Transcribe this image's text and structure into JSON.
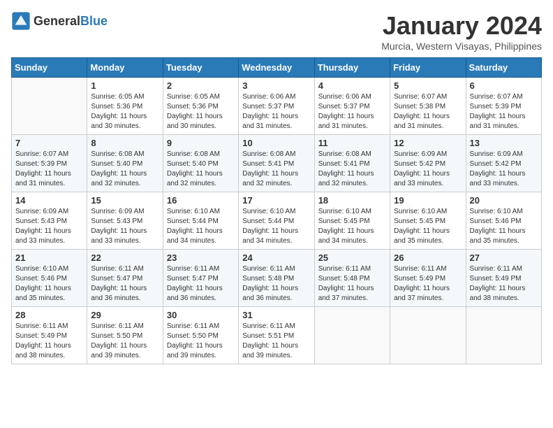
{
  "header": {
    "logo_general": "General",
    "logo_blue": "Blue",
    "month_year": "January 2024",
    "location": "Murcia, Western Visayas, Philippines"
  },
  "weekdays": [
    "Sunday",
    "Monday",
    "Tuesday",
    "Wednesday",
    "Thursday",
    "Friday",
    "Saturday"
  ],
  "weeks": [
    [
      {
        "day": "",
        "content": ""
      },
      {
        "day": "1",
        "content": "Sunrise: 6:05 AM\nSunset: 5:36 PM\nDaylight: 11 hours\nand 30 minutes."
      },
      {
        "day": "2",
        "content": "Sunrise: 6:05 AM\nSunset: 5:36 PM\nDaylight: 11 hours\nand 30 minutes."
      },
      {
        "day": "3",
        "content": "Sunrise: 6:06 AM\nSunset: 5:37 PM\nDaylight: 11 hours\nand 31 minutes."
      },
      {
        "day": "4",
        "content": "Sunrise: 6:06 AM\nSunset: 5:37 PM\nDaylight: 11 hours\nand 31 minutes."
      },
      {
        "day": "5",
        "content": "Sunrise: 6:07 AM\nSunset: 5:38 PM\nDaylight: 11 hours\nand 31 minutes."
      },
      {
        "day": "6",
        "content": "Sunrise: 6:07 AM\nSunset: 5:39 PM\nDaylight: 11 hours\nand 31 minutes."
      }
    ],
    [
      {
        "day": "7",
        "content": "Sunrise: 6:07 AM\nSunset: 5:39 PM\nDaylight: 11 hours\nand 31 minutes."
      },
      {
        "day": "8",
        "content": "Sunrise: 6:08 AM\nSunset: 5:40 PM\nDaylight: 11 hours\nand 32 minutes."
      },
      {
        "day": "9",
        "content": "Sunrise: 6:08 AM\nSunset: 5:40 PM\nDaylight: 11 hours\nand 32 minutes."
      },
      {
        "day": "10",
        "content": "Sunrise: 6:08 AM\nSunset: 5:41 PM\nDaylight: 11 hours\nand 32 minutes."
      },
      {
        "day": "11",
        "content": "Sunrise: 6:08 AM\nSunset: 5:41 PM\nDaylight: 11 hours\nand 32 minutes."
      },
      {
        "day": "12",
        "content": "Sunrise: 6:09 AM\nSunset: 5:42 PM\nDaylight: 11 hours\nand 33 minutes."
      },
      {
        "day": "13",
        "content": "Sunrise: 6:09 AM\nSunset: 5:42 PM\nDaylight: 11 hours\nand 33 minutes."
      }
    ],
    [
      {
        "day": "14",
        "content": "Sunrise: 6:09 AM\nSunset: 5:43 PM\nDaylight: 11 hours\nand 33 minutes."
      },
      {
        "day": "15",
        "content": "Sunrise: 6:09 AM\nSunset: 5:43 PM\nDaylight: 11 hours\nand 33 minutes."
      },
      {
        "day": "16",
        "content": "Sunrise: 6:10 AM\nSunset: 5:44 PM\nDaylight: 11 hours\nand 34 minutes."
      },
      {
        "day": "17",
        "content": "Sunrise: 6:10 AM\nSunset: 5:44 PM\nDaylight: 11 hours\nand 34 minutes."
      },
      {
        "day": "18",
        "content": "Sunrise: 6:10 AM\nSunset: 5:45 PM\nDaylight: 11 hours\nand 34 minutes."
      },
      {
        "day": "19",
        "content": "Sunrise: 6:10 AM\nSunset: 5:45 PM\nDaylight: 11 hours\nand 35 minutes."
      },
      {
        "day": "20",
        "content": "Sunrise: 6:10 AM\nSunset: 5:46 PM\nDaylight: 11 hours\nand 35 minutes."
      }
    ],
    [
      {
        "day": "21",
        "content": "Sunrise: 6:10 AM\nSunset: 5:46 PM\nDaylight: 11 hours\nand 35 minutes."
      },
      {
        "day": "22",
        "content": "Sunrise: 6:11 AM\nSunset: 5:47 PM\nDaylight: 11 hours\nand 36 minutes."
      },
      {
        "day": "23",
        "content": "Sunrise: 6:11 AM\nSunset: 5:47 PM\nDaylight: 11 hours\nand 36 minutes."
      },
      {
        "day": "24",
        "content": "Sunrise: 6:11 AM\nSunset: 5:48 PM\nDaylight: 11 hours\nand 36 minutes."
      },
      {
        "day": "25",
        "content": "Sunrise: 6:11 AM\nSunset: 5:48 PM\nDaylight: 11 hours\nand 37 minutes."
      },
      {
        "day": "26",
        "content": "Sunrise: 6:11 AM\nSunset: 5:49 PM\nDaylight: 11 hours\nand 37 minutes."
      },
      {
        "day": "27",
        "content": "Sunrise: 6:11 AM\nSunset: 5:49 PM\nDaylight: 11 hours\nand 38 minutes."
      }
    ],
    [
      {
        "day": "28",
        "content": "Sunrise: 6:11 AM\nSunset: 5:49 PM\nDaylight: 11 hours\nand 38 minutes."
      },
      {
        "day": "29",
        "content": "Sunrise: 6:11 AM\nSunset: 5:50 PM\nDaylight: 11 hours\nand 39 minutes."
      },
      {
        "day": "30",
        "content": "Sunrise: 6:11 AM\nSunset: 5:50 PM\nDaylight: 11 hours\nand 39 minutes."
      },
      {
        "day": "31",
        "content": "Sunrise: 6:11 AM\nSunset: 5:51 PM\nDaylight: 11 hours\nand 39 minutes."
      },
      {
        "day": "",
        "content": ""
      },
      {
        "day": "",
        "content": ""
      },
      {
        "day": "",
        "content": ""
      }
    ]
  ]
}
